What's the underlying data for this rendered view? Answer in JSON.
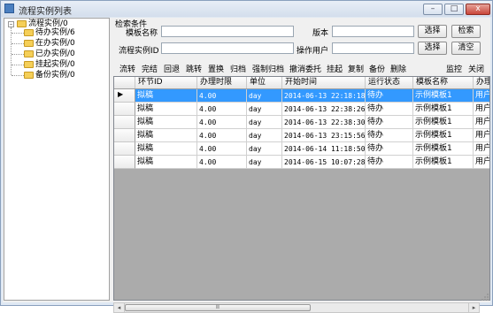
{
  "window": {
    "title": "流程实例列表",
    "min_label": "–",
    "max_label": "□",
    "close_label": "x"
  },
  "tree": {
    "root": "流程实例/0",
    "children": [
      "待办实例/6",
      "在办实例/0",
      "已办实例/0",
      "挂起实例/0",
      "备份实例/0"
    ]
  },
  "search": {
    "group_label": "检索条件",
    "template_label": "模板名称",
    "version_label": "版本",
    "instance_label": "流程实例ID",
    "operator_label": "操作用户",
    "template_value": "",
    "version_value": "",
    "instance_value": "",
    "operator_value": "",
    "select_label": "选择",
    "search_label": "检索",
    "clear_label": "清空"
  },
  "toolbar": {
    "items": [
      "流转",
      "完结",
      "回退",
      "跳转",
      "置换",
      "归档",
      "强制归档",
      "撤消委托",
      "挂起",
      "复制",
      "备份",
      "删除"
    ],
    "right_items": [
      "监控",
      "关闭"
    ]
  },
  "grid": {
    "columns": [
      "环节ID",
      "办理时限",
      "单位",
      "开始时间",
      "运行状态",
      "模板名称",
      "办理"
    ],
    "rows": [
      [
        "拟稿",
        "4.00",
        "day",
        "2014-06-13 22:18:18",
        "待办",
        "示例模板1",
        "用户"
      ],
      [
        "拟稿",
        "4.00",
        "day",
        "2014-06-13 22:38:26",
        "待办",
        "示例模板1",
        "用户"
      ],
      [
        "拟稿",
        "4.00",
        "day",
        "2014-06-13 22:38:30",
        "待办",
        "示例模板1",
        "用户"
      ],
      [
        "拟稿",
        "4.00",
        "day",
        "2014-06-13 23:15:56",
        "待办",
        "示例模板1",
        "用户"
      ],
      [
        "拟稿",
        "4.00",
        "day",
        "2014-06-14 11:18:50",
        "待办",
        "示例模板1",
        "用户"
      ],
      [
        "拟稿",
        "4.00",
        "day",
        "2014-06-15 10:07:28",
        "待办",
        "示例模板1",
        "用户"
      ]
    ],
    "selected_row": 0,
    "current_row_marker": "▶",
    "icons": {
      "row_marker": "triangle-right-icon"
    }
  },
  "scrollbar": {
    "thumb_label": "Ⅲ"
  },
  "colors": {
    "selection": "#3399ff",
    "grid_background": "#ababab"
  }
}
